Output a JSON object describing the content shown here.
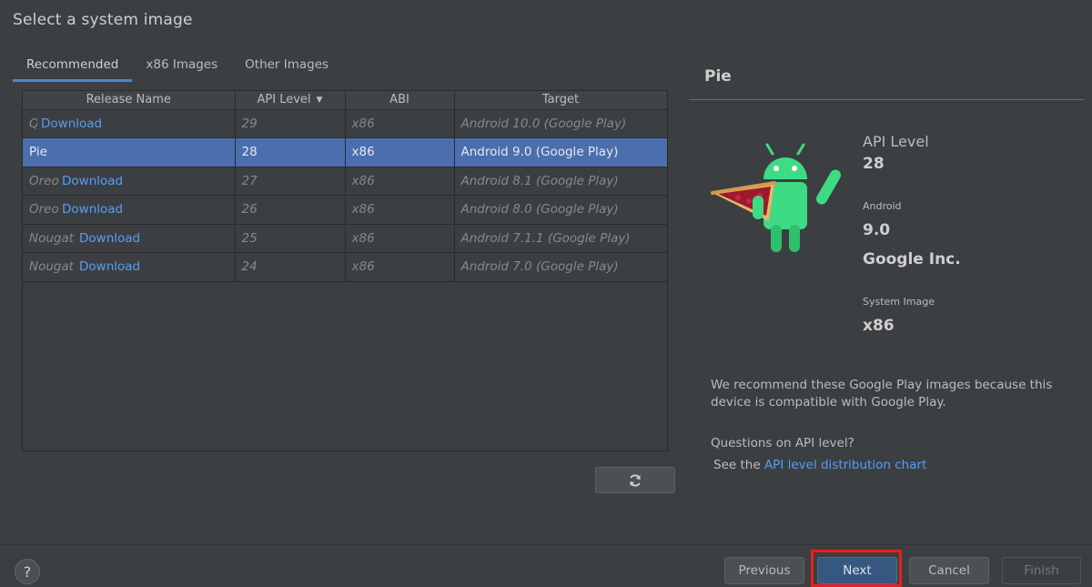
{
  "page_title": "Select a system image",
  "tabs": [
    {
      "label": "Recommended",
      "active": true
    },
    {
      "label": "x86 Images",
      "active": false
    },
    {
      "label": "Other Images",
      "active": false
    }
  ],
  "table": {
    "headers": [
      "Release Name",
      "API Level",
      "ABI",
      "Target"
    ],
    "sorted_column": "API Level",
    "rows": [
      {
        "name": "Q",
        "download": "Download",
        "api": "29",
        "abi": "x86",
        "target": "Android 10.0 (Google Play)",
        "selected": false
      },
      {
        "name": "Pie",
        "download": "",
        "api": "28",
        "abi": "x86",
        "target": "Android 9.0 (Google Play)",
        "selected": true
      },
      {
        "name": "Oreo",
        "download": "Download",
        "api": "27",
        "abi": "x86",
        "target": "Android 8.1 (Google Play)",
        "selected": false
      },
      {
        "name": "Oreo",
        "download": "Download",
        "api": "26",
        "abi": "x86",
        "target": "Android 8.0 (Google Play)",
        "selected": false
      },
      {
        "name": "Nougat",
        "download": "Download",
        "api": "25",
        "abi": "x86",
        "target": "Android 7.1.1 (Google Play)",
        "selected": false
      },
      {
        "name": "Nougat",
        "download": "Download",
        "api": "24",
        "abi": "x86",
        "target": "Android 7.0 (Google Play)",
        "selected": false
      }
    ]
  },
  "refresh_icon": "refresh-icon",
  "detail": {
    "title": "Pie",
    "api_label": "API Level",
    "api_value": "28",
    "android_label": "Android",
    "android_version": "9.0",
    "vendor": "Google Inc.",
    "system_image_label": "System Image",
    "system_image_value": "x86",
    "description": "We recommend these Google Play images because this device is compatible with Google Play.",
    "question": "Questions on API level?",
    "see_prefix": "See the",
    "link_text": "API level distribution chart"
  },
  "footer": {
    "help": "?",
    "previous": "Previous",
    "next": "Next",
    "cancel": "Cancel",
    "finish": "Finish"
  },
  "colors": {
    "background": "#3c3f41",
    "selection": "#4b6eaf",
    "link": "#589df6",
    "primary_button": "#365880",
    "highlight": "#e8201b"
  }
}
